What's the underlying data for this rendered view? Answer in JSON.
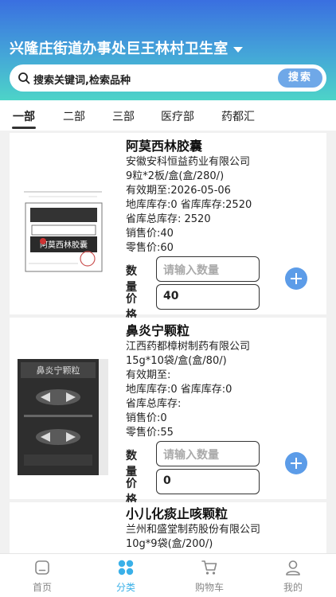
{
  "header": {
    "clinic_name": "兴隆庄街道办事处巨王林村卫生室",
    "search_placeholder": "搜索关键词,检索品种",
    "search_button": "搜索"
  },
  "tabs": [
    "一部",
    "二部",
    "三部",
    "医疗部",
    "药都汇"
  ],
  "active_tab": "一部",
  "products": [
    {
      "name": "阿莫西林胶囊",
      "manufacturer": "安徽安科恒益药业有限公司",
      "spec": "9粒*2板/盒(盒/280/)",
      "expiry": "有效期至:2026-05-06",
      "stock": "地库库存:0 省库库存:2520",
      "province_total": "省库总库存:  2520",
      "sale_price": "销售价:40",
      "retail_price": "零售价:60",
      "qty_label": "数量",
      "qty_placeholder": "请输入数量",
      "price_label": "价格",
      "price_value": "40",
      "box_text": "阿莫西林胶囊"
    },
    {
      "name": "鼻炎宁颗粒",
      "manufacturer": "江西药都樟树制药有限公司",
      "spec": "15g*10袋/盒(盒/80/)",
      "expiry": "有效期至:",
      "stock": "地库库存:0 省库库存:0",
      "province_total": "省库总库存:",
      "sale_price": "销售价:0",
      "retail_price": "零售价:55",
      "qty_label": "数量",
      "qty_placeholder": "请输入数量",
      "price_label": "价格",
      "price_value": "0",
      "box_text": "鼻炎宁颗粒"
    },
    {
      "name": "小儿化痰止咳颗粒",
      "manufacturer": "兰州和盛堂制药股份有限公司",
      "spec": "10g*9袋(盒/200/)"
    }
  ],
  "tabbar": [
    {
      "label": "首页",
      "icon": "home-icon"
    },
    {
      "label": "分类",
      "icon": "category-icon"
    },
    {
      "label": "购物车",
      "icon": "cart-icon"
    },
    {
      "label": "我的",
      "icon": "profile-icon"
    }
  ],
  "active_tabbar": "分类",
  "colors": {
    "header_gradient": [
      "#3a6fe0",
      "#4dd4c8"
    ],
    "accent": "#5c9ce8",
    "active_tabbar": "#3ab0e8"
  }
}
